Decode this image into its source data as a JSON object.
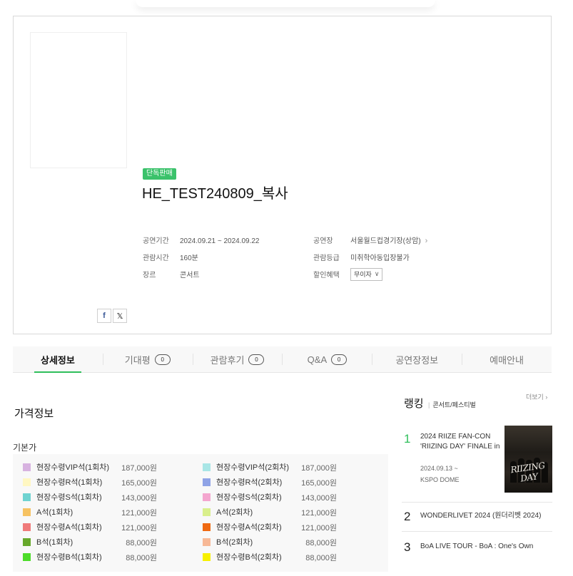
{
  "product": {
    "badge": "단독판매",
    "title": "HE_TEST240809_복사",
    "info": {
      "period_label": "공연기간",
      "period_value": "2024.09.21 ~ 2024.09.22",
      "runtime_label": "관람시간",
      "runtime_value": "160분",
      "genre_label": "장르",
      "genre_value": "콘서트",
      "venue_label": "공연장",
      "venue_value": "서울월드컵경기장(상암)",
      "rating_label": "관람등급",
      "rating_value": "미취학아동입장불가",
      "discount_label": "할인혜택",
      "discount_value": "무이자"
    },
    "share": {
      "facebook": "f",
      "x": "𝕏"
    }
  },
  "tabs": [
    {
      "label": "상세정보",
      "count": ""
    },
    {
      "label": "기대평",
      "count": "0"
    },
    {
      "label": "관람후기",
      "count": "0"
    },
    {
      "label": "Q&A",
      "count": "0"
    },
    {
      "label": "공연장정보",
      "count": ""
    },
    {
      "label": "예매안내",
      "count": ""
    }
  ],
  "price_section": {
    "title": "가격정보",
    "subheading": "기본가",
    "left": [
      {
        "label": "현장수령VIP석(1회차)",
        "price": "187,000원",
        "color": "#d7b2e0"
      },
      {
        "label": "현장수령R석(1회차)",
        "price": "165,000원",
        "color": "#fff7c2"
      },
      {
        "label": "현장수령S석(1회차)",
        "price": "143,000원",
        "color": "#6fd3d1"
      },
      {
        "label": "A석(1회차)",
        "price": "121,000원",
        "color": "#f6c262"
      },
      {
        "label": "현장수령A석(1회차)",
        "price": "121,000원",
        "color": "#ef7a7a"
      },
      {
        "label": "B석(1회차)",
        "price": "88,000원",
        "color": "#67a82b"
      },
      {
        "label": "현장수령B석(1회차)",
        "price": "88,000원",
        "color": "#4ddc2a"
      }
    ],
    "right": [
      {
        "label": "현장수령VIP석(2회차)",
        "price": "187,000원",
        "color": "#a9e6e6"
      },
      {
        "label": "현장수령R석(2회차)",
        "price": "165,000원",
        "color": "#8fa3e6"
      },
      {
        "label": "현장수령S석(2회차)",
        "price": "143,000원",
        "color": "#f4a6cf"
      },
      {
        "label": "A석(2회차)",
        "price": "121,000원",
        "color": "#d9ef8c"
      },
      {
        "label": "현장수령A석(2회차)",
        "price": "121,000원",
        "color": "#ef6a12"
      },
      {
        "label": "B석(2회차)",
        "price": "88,000원",
        "color": "#f7b896"
      },
      {
        "label": "현장수령B석(2회차)",
        "price": "88,000원",
        "color": "#f7f000"
      }
    ]
  },
  "ranking": {
    "title": "랭킹",
    "category": "콘서트/페스티벌",
    "more": "더보기",
    "items": [
      {
        "rank": "1",
        "name_line1": "2024 RIIZE FAN-CON",
        "name_line2": "'RIIZING DAY' FINALE in",
        "date": "2024.09.13 ~",
        "venue": "KSPO DOME"
      },
      {
        "rank": "2",
        "name_line1": "WONDERLIVET 2024 (원더리벳 2024)"
      },
      {
        "rank": "3",
        "name_line1": "BoA LIVE TOUR - BoA : One's Own"
      }
    ],
    "poster_text": "RIIZING DAY"
  }
}
